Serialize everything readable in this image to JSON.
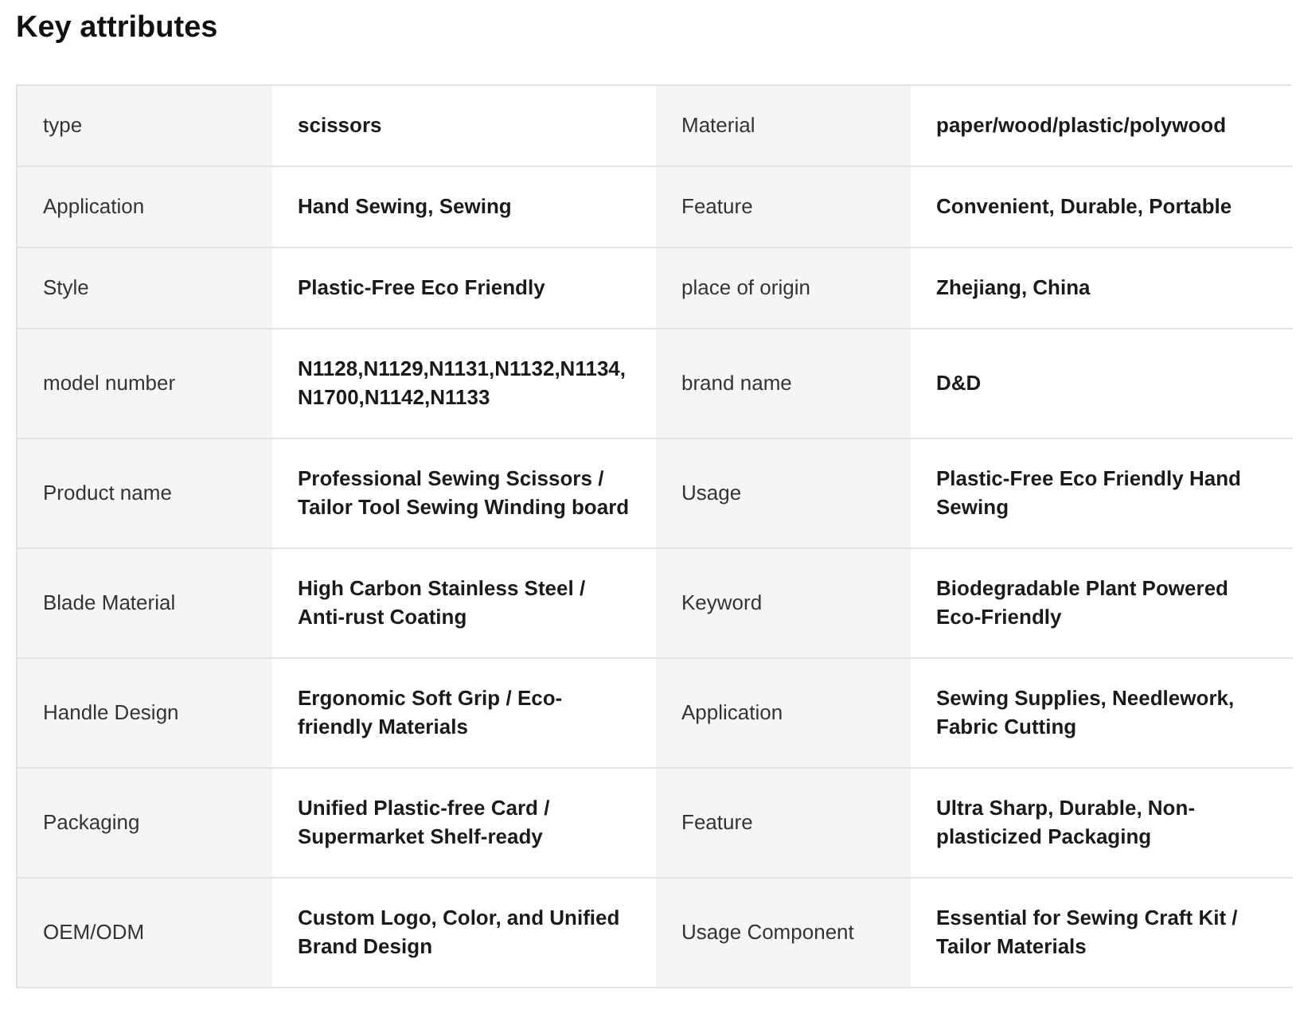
{
  "title": "Key attributes",
  "rows": [
    [
      {
        "label": "type",
        "value": "scissors"
      },
      {
        "label": "Material",
        "value": "paper/wood/plastic/polywood"
      }
    ],
    [
      {
        "label": "Application",
        "value": "Hand Sewing, Sewing"
      },
      {
        "label": "Feature",
        "value": "Convenient, Durable, Portable"
      }
    ],
    [
      {
        "label": "Style",
        "value": "Plastic-Free Eco Friendly"
      },
      {
        "label": "place of origin",
        "value": "Zhejiang, China"
      }
    ],
    [
      {
        "label": "model number",
        "value": "N1128,N1129,N1131,N1132,N1134, N1700,N1142,N1133"
      },
      {
        "label": "brand name",
        "value": "D&D"
      }
    ],
    [
      {
        "label": "Product name",
        "value": "Professional Sewing Scissors / Tailor Tool Sewing Winding board"
      },
      {
        "label": "Usage",
        "value": "Plastic-Free Eco Friendly Hand Sewing"
      }
    ],
    [
      {
        "label": "Blade Material",
        "value": "High Carbon Stainless Steel / Anti-rust Coating"
      },
      {
        "label": "Keyword",
        "value": "Biodegradable Plant Powered Eco-Friendly"
      }
    ],
    [
      {
        "label": "Handle Design",
        "value": "Ergonomic Soft Grip / Eco-friendly Materials"
      },
      {
        "label": "Application",
        "value": "Sewing Supplies, Needlework, Fabric Cutting"
      }
    ],
    [
      {
        "label": "Packaging",
        "value": "Unified Plastic-free Card / Supermarket Shelf-ready"
      },
      {
        "label": "Feature",
        "value": "Ultra Sharp, Durable, Non-plasticized Packaging"
      }
    ],
    [
      {
        "label": "OEM/ODM",
        "value": "Custom Logo, Color, and Unified Brand Design"
      },
      {
        "label": "Usage Component",
        "value": "Essential for Sewing Craft Kit / Tailor Materials"
      }
    ]
  ]
}
